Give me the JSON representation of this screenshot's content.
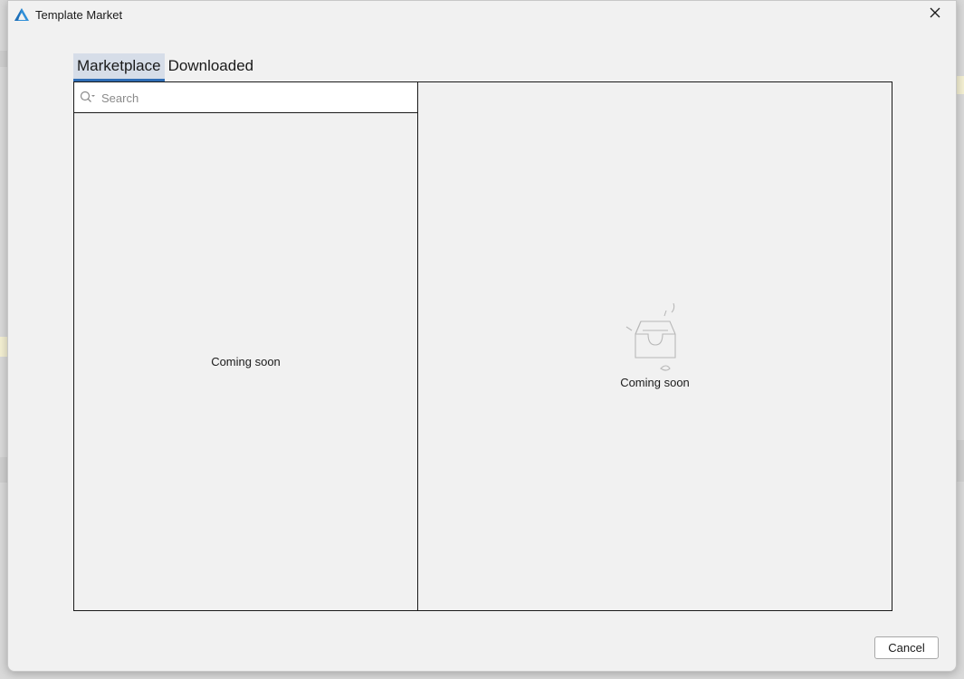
{
  "window": {
    "title": "Template Market",
    "icon": "app-logo-icon",
    "close_icon": "close-icon"
  },
  "tabs": [
    {
      "label": "Marketplace",
      "active": true
    },
    {
      "label": "Downloaded",
      "active": false
    }
  ],
  "search": {
    "placeholder": "Search",
    "value": "",
    "icon": "search-icon"
  },
  "list_pane": {
    "empty_text": "Coming soon"
  },
  "detail_pane": {
    "empty_icon": "empty-inbox-icon",
    "empty_text": "Coming soon"
  },
  "footer": {
    "cancel_label": "Cancel"
  },
  "colors": {
    "dialog_bg": "#f1f1f1",
    "tab_active_bg": "#d6dde8",
    "tab_active_accent": "#2f6db5",
    "border": "#1a1a1a"
  }
}
